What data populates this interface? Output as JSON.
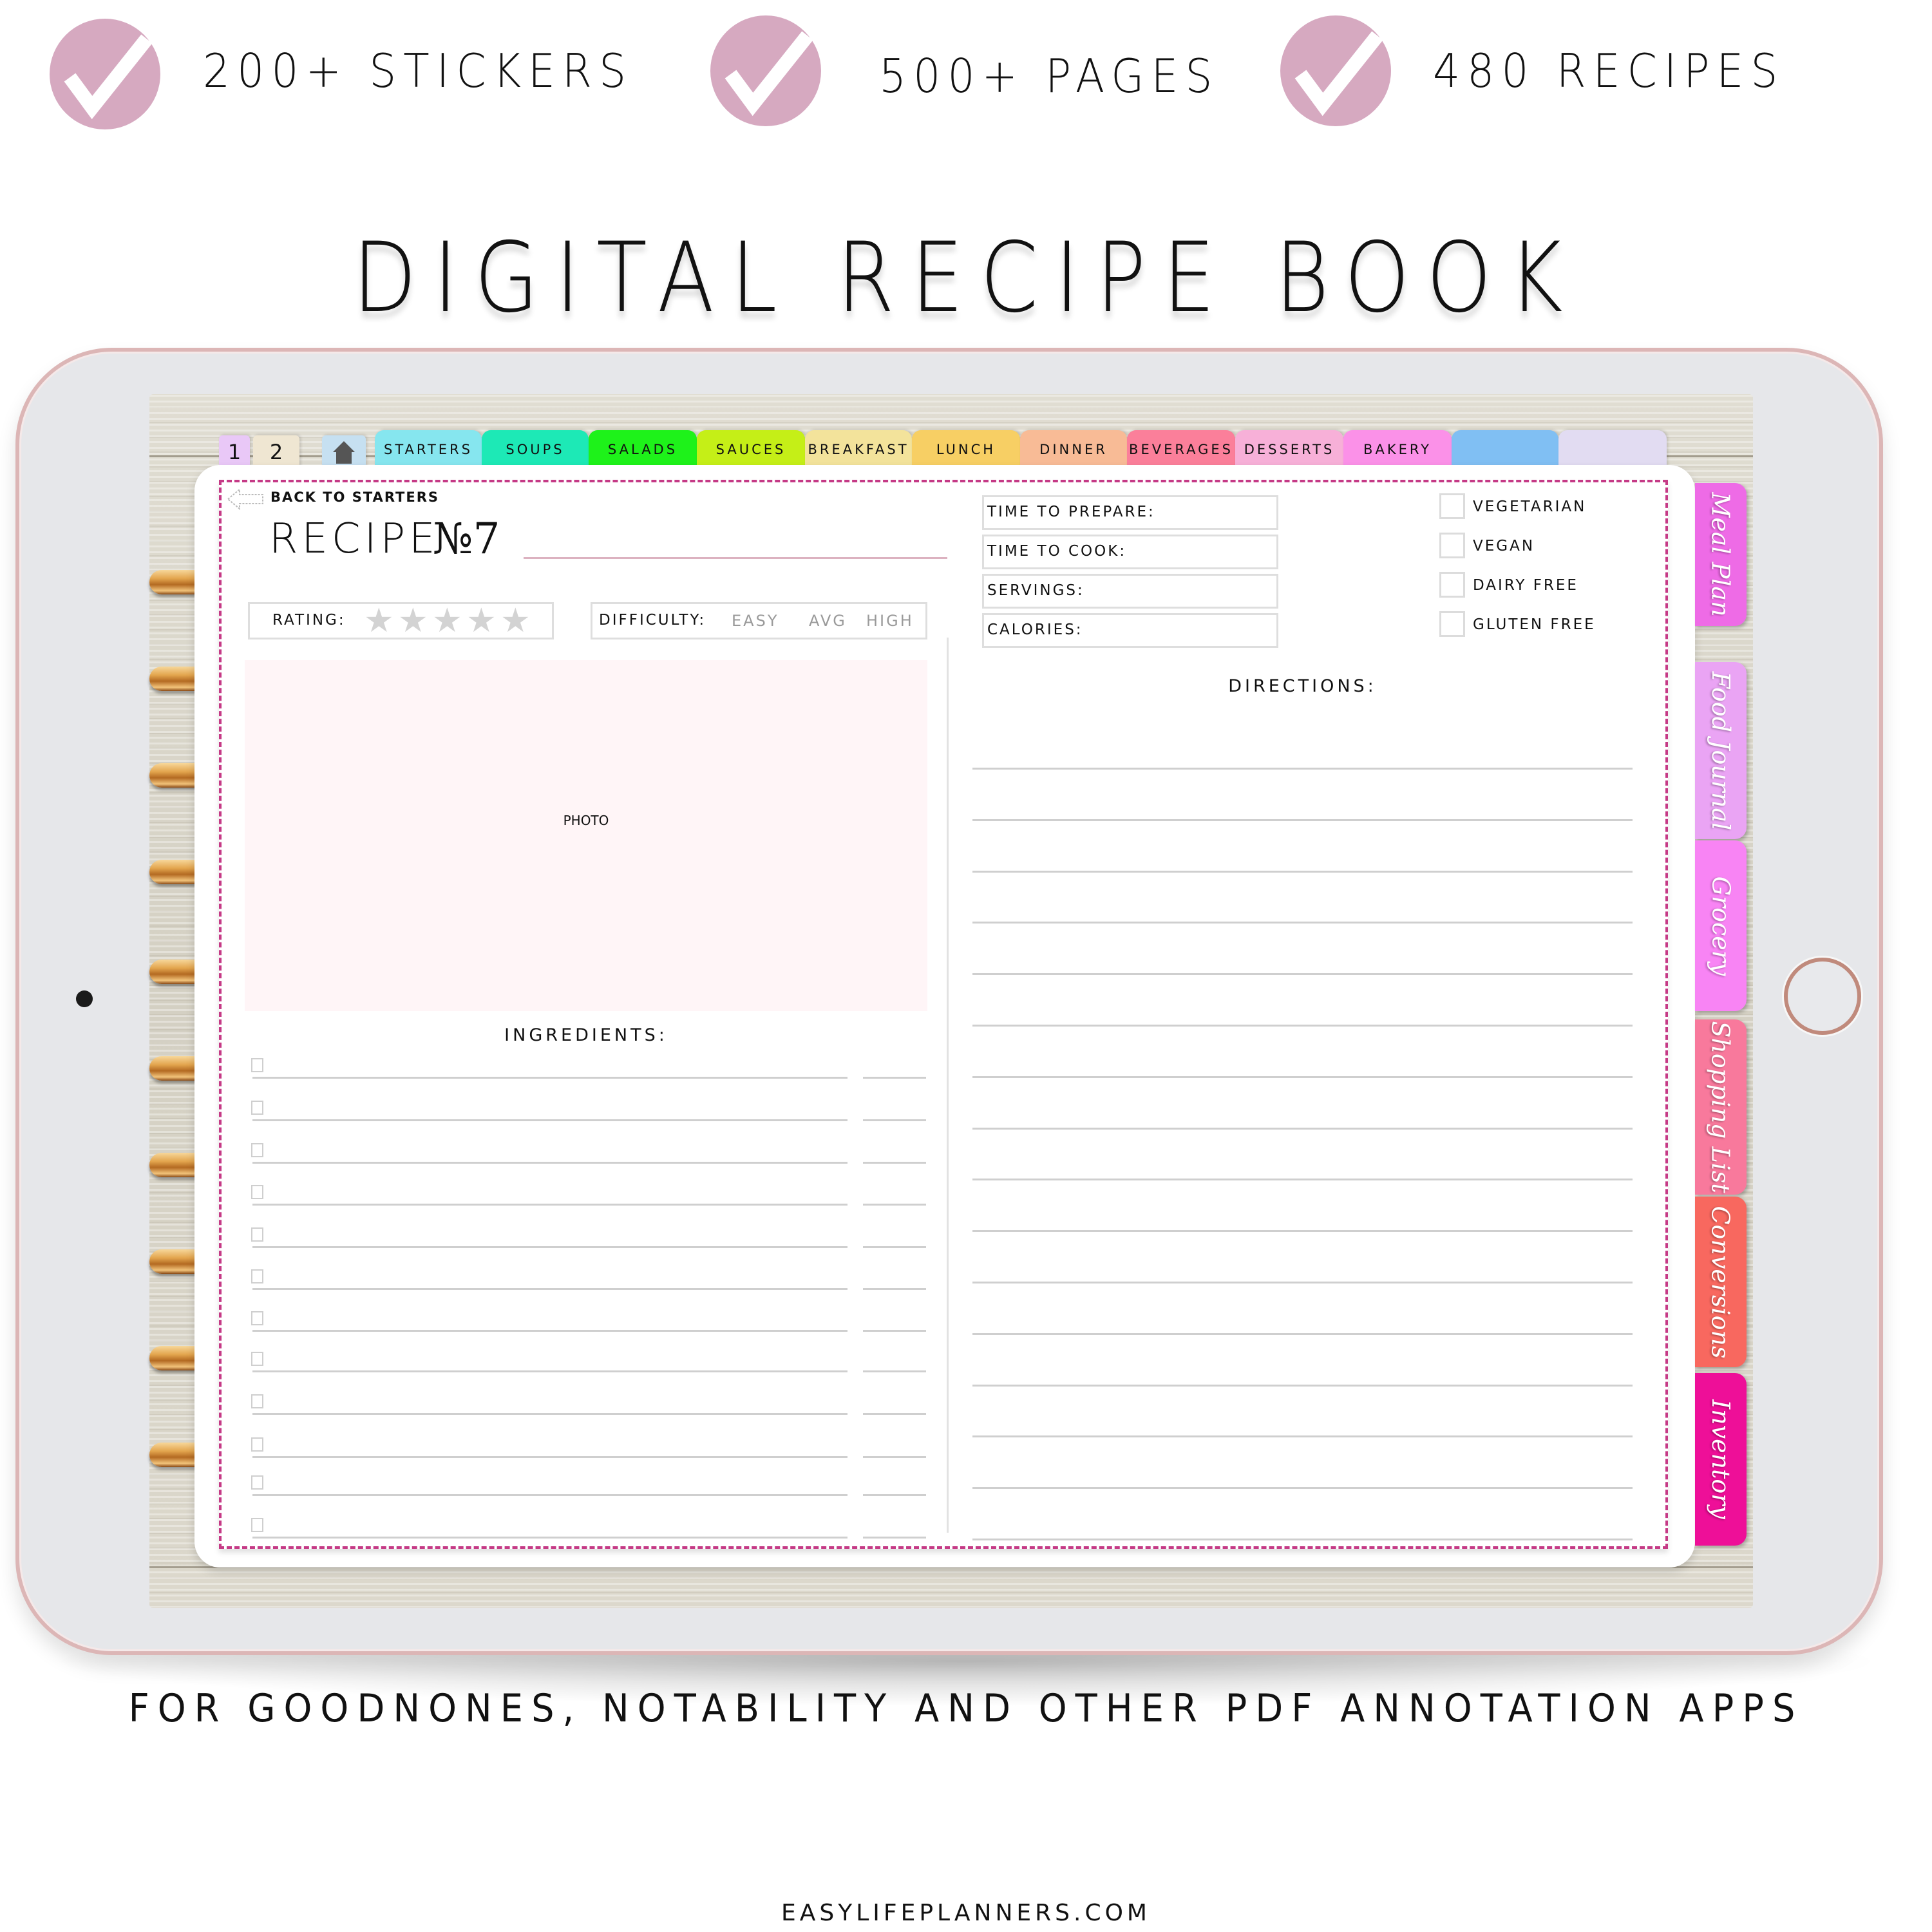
{
  "features": [
    {
      "icon": "check-icon",
      "label": "200+ STICKERS"
    },
    {
      "icon": "check-icon",
      "label": "500+ PAGES"
    },
    {
      "icon": "check-icon",
      "label": "480 RECIPES"
    }
  ],
  "title": "DIGITAL RECIPE BOOK",
  "colors": {
    "check_circle": "#d6a9c0",
    "dashed_border": "#c53a86",
    "photo_bg": "#fff5f7",
    "ipad_frame": "#dcb6b6"
  },
  "top_tabs": [
    {
      "label": "1",
      "color": "#e9c8f7"
    },
    {
      "label": "2",
      "color": "#efe6d2"
    },
    {
      "label": "",
      "icon": "home-icon",
      "color": "#c6e0f1"
    },
    {
      "label": "STARTERS",
      "color": "#86e6ef"
    },
    {
      "label": "SOUPS",
      "color": "#1de9b6"
    },
    {
      "label": "SALADS",
      "color": "#1ef21a"
    },
    {
      "label": "SAUCES",
      "color": "#c5ef17"
    },
    {
      "label": "BREAKFAST",
      "color": "#f3e39b"
    },
    {
      "label": "LUNCH",
      "color": "#f7cf64"
    },
    {
      "label": "DINNER",
      "color": "#f8bb96"
    },
    {
      "label": "BEVERAGES",
      "color": "#fb7f9a"
    },
    {
      "label": "DESSERTS",
      "color": "#f7b0d8"
    },
    {
      "label": "BAKERY",
      "color": "#fb91e8"
    },
    {
      "label": "",
      "color": "#80bff3"
    },
    {
      "label": "",
      "color": "#e2dcf2"
    }
  ],
  "side_tabs": [
    {
      "label": "Meal Plan",
      "color": "#ee6be6"
    },
    {
      "label": "Food Journal",
      "color": "#eaa4f4"
    },
    {
      "label": "Grocery",
      "color": "#f884f4"
    },
    {
      "label": "Shopping List",
      "color": "#f8799c"
    },
    {
      "label": "Conversions",
      "color": "#f8685f"
    },
    {
      "label": "Inventory",
      "color": "#ee0f98"
    }
  ],
  "page": {
    "back_link": "BACK TO STARTERS",
    "recipe_label": "RECIPE",
    "recipe_number": "№7",
    "recipe_name_value": "",
    "rating_label": "RATING:",
    "rating_value": 0,
    "rating_max": 5,
    "difficulty_label": "DIFFICULTY:",
    "difficulty_options": [
      "EASY",
      "AVG",
      "HIGH"
    ],
    "photo_label": "PHOTO",
    "ingredients_title": "INGREDIENTS:",
    "ingredient_rows": 12,
    "directions_title": "DIRECTIONS:",
    "direction_lines": 16,
    "info_fields": [
      {
        "label": "TIME TO PREPARE:",
        "value": ""
      },
      {
        "label": "TIME TO COOK:",
        "value": ""
      },
      {
        "label": "SERVINGS:",
        "value": ""
      },
      {
        "label": "CALORIES:",
        "value": ""
      }
    ],
    "diet_options": [
      {
        "label": "VEGETARIAN",
        "checked": false
      },
      {
        "label": "VEGAN",
        "checked": false
      },
      {
        "label": "DAIRY FREE",
        "checked": false
      },
      {
        "label": "GLUTEN FREE",
        "checked": false
      }
    ]
  },
  "footer": {
    "compat": "FOR GOODNONES, NOTABILITY AND OTHER PDF ANNOTATION APPS",
    "url": "EASYLIFEPLANNERS.COM"
  }
}
